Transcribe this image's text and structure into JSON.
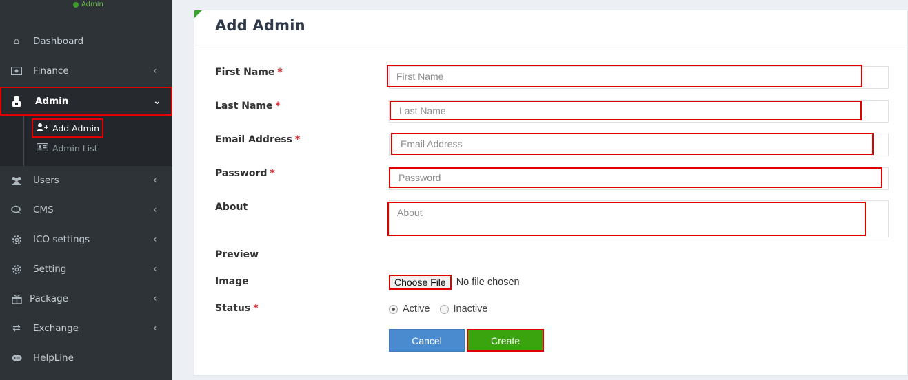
{
  "sidebar": {
    "status": "Admin",
    "items": [
      {
        "label": "Dashboard",
        "icon": "home-icon"
      },
      {
        "label": "Finance",
        "icon": "money-icon"
      },
      {
        "label": "Admin",
        "icon": "admin-icon"
      },
      {
        "label": "Users",
        "icon": "users-icon"
      },
      {
        "label": "CMS",
        "icon": "chat-icon"
      },
      {
        "label": "ICO settings",
        "icon": "gear-icon"
      },
      {
        "label": "Setting",
        "icon": "cog-icon"
      },
      {
        "label": "Package",
        "icon": "gift-icon"
      },
      {
        "label": "Exchange",
        "icon": "exchange-icon"
      },
      {
        "label": "HelpLine",
        "icon": "comment-icon"
      }
    ],
    "submenu": [
      {
        "label": "Add Admin",
        "icon": "user-plus-icon"
      },
      {
        "label": "Admin List",
        "icon": "id-card-icon"
      }
    ]
  },
  "page": {
    "title": "Add Admin"
  },
  "form": {
    "required_mark": "*",
    "first_name": {
      "label": "First Name",
      "placeholder": "First Name"
    },
    "last_name": {
      "label": "Last Name",
      "placeholder": "Last Name"
    },
    "email": {
      "label": "Email Address",
      "placeholder": "Email Address"
    },
    "password": {
      "label": "Password",
      "placeholder": "Password"
    },
    "about": {
      "label": "About",
      "placeholder": "About"
    },
    "preview": {
      "label": "Preview"
    },
    "image": {
      "label": "Image",
      "button": "Choose File",
      "status": "No file chosen"
    },
    "status": {
      "label": "Status",
      "options": [
        "Active",
        "Inactive"
      ],
      "selected": "Active"
    },
    "cancel_label": "Cancel",
    "create_label": "Create"
  },
  "colors": {
    "sidebar_bg": "#2e3338",
    "highlight": "#e00000",
    "create_button": "#39a40d",
    "cancel_button": "#4a8bd0",
    "required": "#d9232a"
  }
}
